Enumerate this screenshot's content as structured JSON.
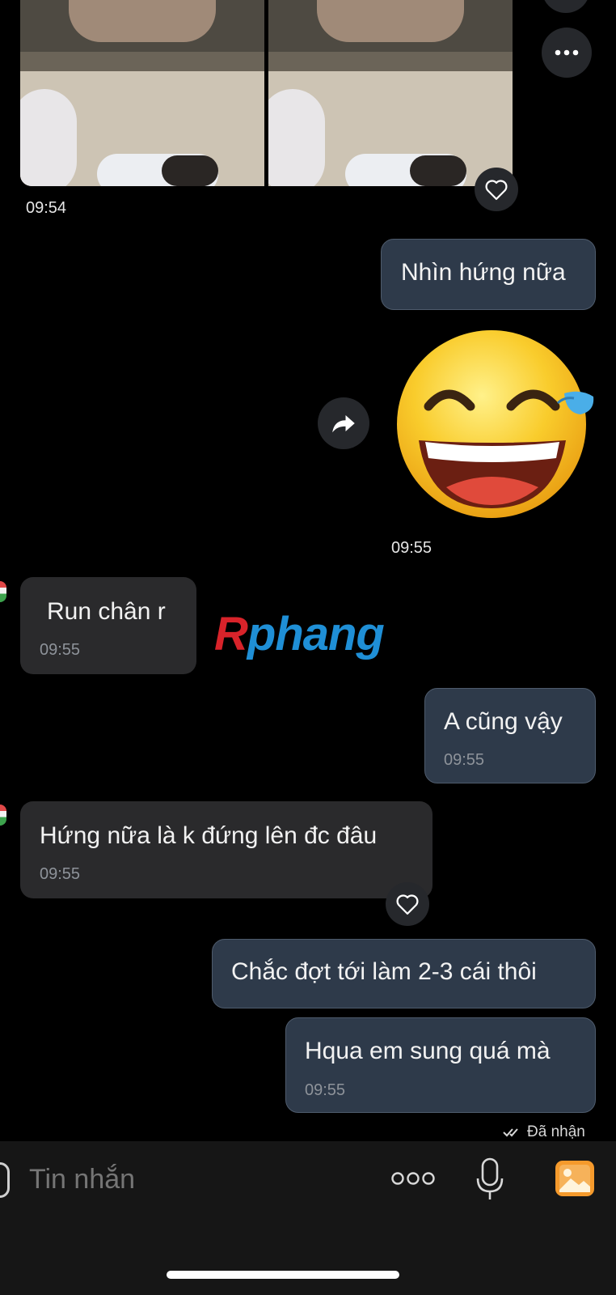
{
  "messages": {
    "photo_time": "09:54",
    "out_1": "Nhìn hứng nữa",
    "sticker_time": "09:55",
    "in_1": {
      "text": "Run chân r",
      "time": "09:55"
    },
    "out_2": {
      "text": "A cũng vậy",
      "time": "09:55"
    },
    "in_2": {
      "text": "Hứng nữa là k đứng lên đc đâu",
      "time": "09:55"
    },
    "out_3": "Chắc đợt tới làm 2-3 cái thôi",
    "out_4": {
      "text": "Hqua em sung quá mà",
      "time": "09:55"
    },
    "status": "Đã nhận"
  },
  "watermark": {
    "first": "R",
    "rest": "phang"
  },
  "composer": {
    "placeholder": "Tin nhắn"
  },
  "icons": [
    "more-icon",
    "heart-icon",
    "share-icon",
    "sticker-emoji-icon",
    "double-check-icon",
    "sticker-icon",
    "more-options-icon",
    "microphone-icon",
    "image-icon"
  ]
}
